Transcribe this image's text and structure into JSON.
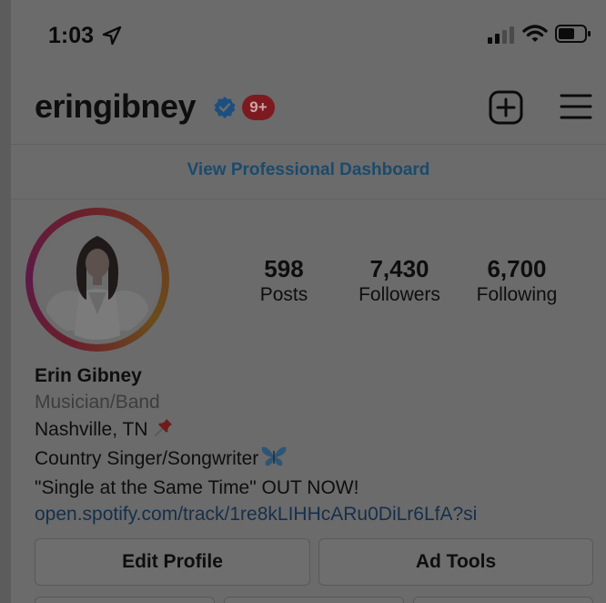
{
  "status_bar": {
    "time": "1:03",
    "icons": [
      "location-arrow-icon",
      "cellular-signal-icon",
      "wifi-icon",
      "battery-icon"
    ]
  },
  "header": {
    "username": "eringibney",
    "verified": true,
    "notification_badge": "9+",
    "icons": [
      "verified-badge-icon",
      "new-post-icon",
      "menu-icon"
    ]
  },
  "professional_dashboard": {
    "label": "View Professional Dashboard"
  },
  "stats": {
    "posts": {
      "count": "598",
      "label": "Posts"
    },
    "followers": {
      "count": "7,430",
      "label": "Followers"
    },
    "following": {
      "count": "6,700",
      "label": "Following"
    }
  },
  "bio": {
    "name": "Erin Gibney",
    "category": "Musician/Band",
    "location": "Nashville, TN",
    "location_emoji": "pushpin-icon",
    "line_3": "Country Singer/Songwriter",
    "line_3_emoji": "butterfly-icon",
    "line_4": "\"Single at the Same Time\" OUT NOW!",
    "link": "open.spotify.com/track/1re8kLIHHcARu0DiLr6LfA?si"
  },
  "buttons": {
    "edit_profile": "Edit Profile",
    "ad_tools": "Ad Tools"
  },
  "colors": {
    "overlay_background": "#6b6b6b",
    "link_blue": "#1b4a6c",
    "badge_red": "#7c1a20",
    "verified_blue": "#1c4f80"
  }
}
